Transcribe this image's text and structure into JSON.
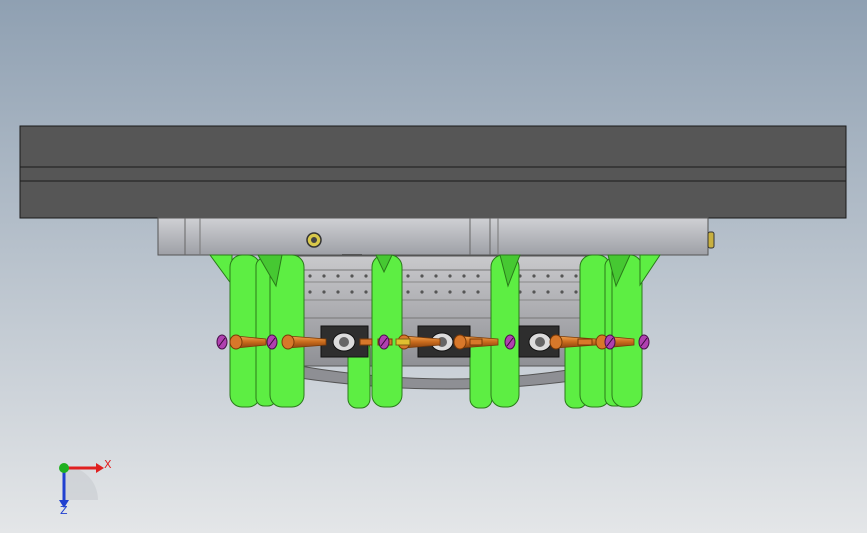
{
  "viewport": {
    "background_top": "#8fa0b2",
    "background_bottom": "#e4e6e8"
  },
  "model": {
    "plate_color": "#565656",
    "housing_color": "#b4b4b8",
    "clamp_color": "#5dee43",
    "pin_color": "#d8782a",
    "bolt_color": "#b040b0",
    "block_color": "#2e2e2e"
  },
  "triad": {
    "x_label": "X",
    "z_label": "Z",
    "x_color": "#e02020",
    "y_color": "#20b020",
    "z_color": "#2040d0"
  }
}
